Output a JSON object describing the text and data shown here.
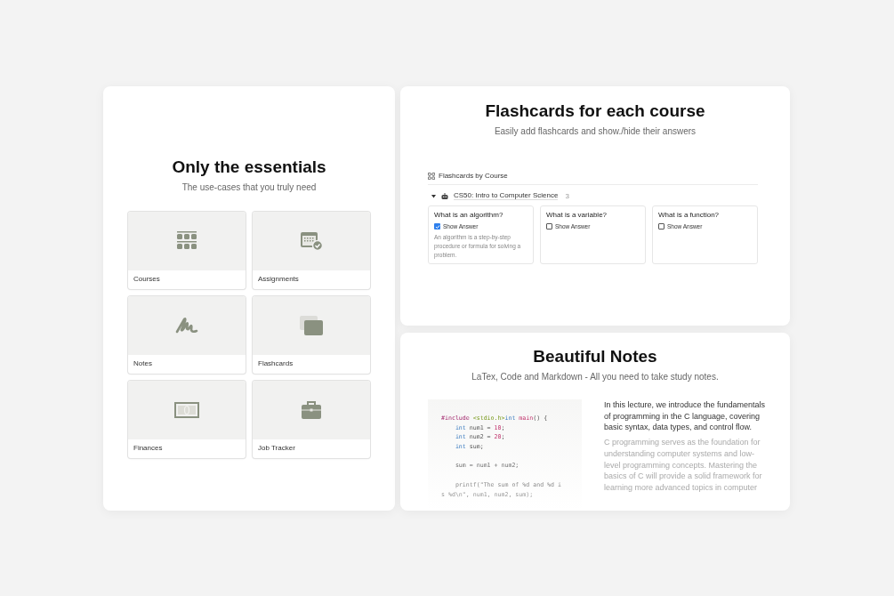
{
  "essentials": {
    "title": "Only the essentials",
    "subtitle": "The use-cases that you truly need",
    "tiles": [
      {
        "label": "Courses",
        "kind": "grid"
      },
      {
        "label": "Assignments",
        "kind": "calendar"
      },
      {
        "label": "Notes",
        "kind": "scribble"
      },
      {
        "label": "Flashcards",
        "kind": "cards"
      },
      {
        "label": "Finances",
        "kind": "money"
      },
      {
        "label": "Job Tracker",
        "kind": "briefcase"
      }
    ]
  },
  "flashcards": {
    "title": "Flashcards for each course",
    "subtitle": "Easily add flashcards and show./hide their answers",
    "view": "Flashcards by Course",
    "group": {
      "name": "CS50: Intro to Computer Science",
      "count": "3",
      "expanded": true
    },
    "cards": [
      {
        "question": "What is an algorithm?",
        "toggle": "Show Answer",
        "checked": true,
        "answer": "An algorithm is a step-by-step procedure or formula for solving a problem."
      },
      {
        "question": "What is a variable?",
        "toggle": "Show Answer",
        "checked": false
      },
      {
        "question": "What is a function?",
        "toggle": "Show Answer",
        "checked": false
      }
    ]
  },
  "notes": {
    "title": "Beautiful Notes",
    "subtitle": "LaTex, Code and Markdown - All you need to take study notes.",
    "code": [
      {
        "kind": "code",
        "tokens": [
          {
            "t": "#include ",
            "kind": "macro"
          },
          {
            "t": "<stdio.h>",
            "kind": "string"
          },
          {
            "t": "int ",
            "kind": "type"
          },
          {
            "t": "main",
            "kind": "func"
          },
          {
            "t": "() {",
            "kind": "plain"
          }
        ]
      },
      {
        "kind": "code",
        "tokens": [
          {
            "t": "    int ",
            "kind": "type"
          },
          {
            "t": "num1 = ",
            "kind": "plain"
          },
          {
            "t": "10",
            "kind": "number"
          },
          {
            "t": ";",
            "kind": "plain"
          }
        ]
      },
      {
        "kind": "code",
        "tokens": [
          {
            "t": "    int ",
            "kind": "type"
          },
          {
            "t": "num2 = ",
            "kind": "plain"
          },
          {
            "t": "20",
            "kind": "number"
          },
          {
            "t": ";",
            "kind": "plain"
          }
        ]
      },
      {
        "kind": "code",
        "tokens": [
          {
            "t": "    int ",
            "kind": "type"
          },
          {
            "t": "sum;",
            "kind": "plain"
          }
        ]
      },
      {
        "kind": "blank"
      },
      {
        "kind": "code",
        "tokens": [
          {
            "t": "    sum = num1 + num2;",
            "kind": "plain"
          }
        ]
      },
      {
        "kind": "blank"
      },
      {
        "kind": "code",
        "tokens": [
          {
            "t": "    printf(\"The sum of %d and %d i",
            "kind": "plain"
          }
        ]
      },
      {
        "kind": "code",
        "tokens": [
          {
            "t": "s %d\\n\", num1, num2, sum);",
            "kind": "plain"
          }
        ]
      }
    ],
    "paragraphs": [
      "In this lecture, we introduce the fundamentals of programming in the C language, covering basic syntax, data types, and control flow.",
      "C programming serves as the foundation for understanding computer systems and low-level programming concepts. Mastering the basics of C will provide a solid framework for learning more advanced topics in computer"
    ]
  }
}
